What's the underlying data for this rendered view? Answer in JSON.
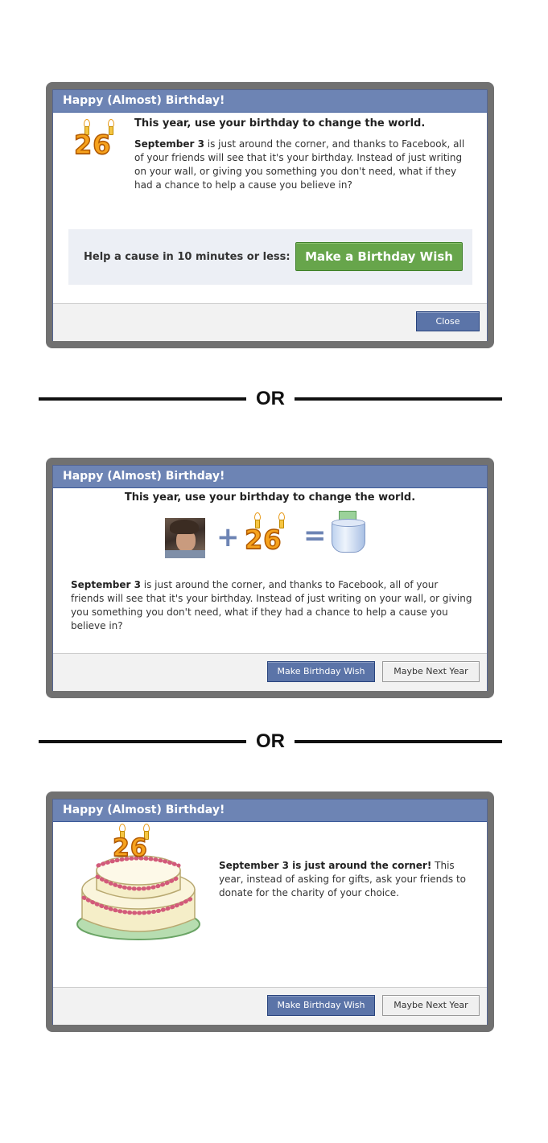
{
  "dialogs": [
    {
      "title": "Happy (Almost) Birthday!",
      "age": "26",
      "headline": "This year, use your birthday to change the world.",
      "date": "September 3",
      "body": " is just around the corner, and thanks to Facebook, all of your friends will see that it's your birthday. Instead of just writing on your wall, or giving you something you don't need, what if they had a chance to help a cause you believe in?",
      "cta_text": "Help a cause in 10 minutes or less:",
      "cta_button": "Make a Birthday Wish",
      "close_button": "Close"
    },
    {
      "title": "Happy (Almost) Birthday!",
      "age": "26",
      "headline": "This year, use your birthday to change the world.",
      "plus": "+",
      "equals": "=",
      "date": "September 3",
      "body": " is just around the corner, and thanks to Facebook, all of your friends will see that it's your birthday. Instead of just writing on your wall, or giving you something you don't need, what if they had a chance to help a cause you believe in?",
      "primary_button": "Make Birthday Wish",
      "secondary_button": "Maybe Next Year"
    },
    {
      "title": "Happy (Almost) Birthday!",
      "age": "26",
      "date_headline": "September 3 is just around the corner!",
      "body": " This year, instead of asking for gifts, ask your friends to donate for the charity of your choice.",
      "primary_button": "Make Birthday Wish",
      "secondary_button": "Maybe Next Year"
    }
  ],
  "separators": [
    "OR",
    "OR"
  ],
  "colors": {
    "title_bar": "#6d84b4",
    "frame": "#717171",
    "primary_button": "#5b74a8",
    "green_button": "#67a54b",
    "age_number": "#f6a21d"
  }
}
